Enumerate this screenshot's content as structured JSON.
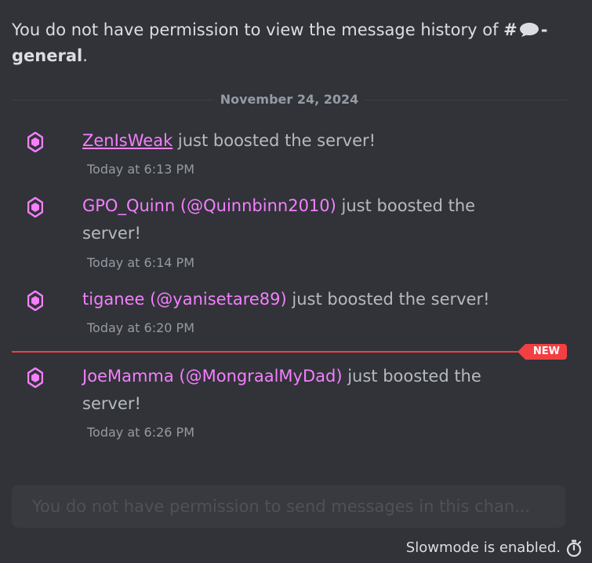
{
  "history_notice": {
    "prefix": "You do not have permission to view the message history of",
    "channel_hash": "#",
    "channel_name": "- general",
    "suffix": "."
  },
  "date_divider": {
    "label": "November 24, 2024"
  },
  "messages": [
    {
      "username": "ZenIsWeak",
      "action": " just boosted the server!",
      "timestamp": "Today at 6:13 PM"
    },
    {
      "username": "GPO_Quinn (@Quinnbinn2010)",
      "action": " just boosted the server!",
      "timestamp": "Today at 6:14 PM"
    },
    {
      "username": "tiganee (@yanisetare89)",
      "action": " just boosted the server!",
      "timestamp": "Today at 6:20 PM"
    },
    {
      "username": "JoeMamma (@MongraalMyDad)",
      "action": " just boosted the server!",
      "timestamp": "Today at 6:26 PM"
    }
  ],
  "new_divider": {
    "badge": "NEW"
  },
  "composer": {
    "placeholder": "You do not have permission to send messages in this chan..."
  },
  "footer": {
    "slowmode_label": "Slowmode is enabled.",
    "slowmode_icon": "stopwatch-icon"
  },
  "colors": {
    "background": "#313338",
    "boost_pink": "#f47fff",
    "new_red": "#f23f43",
    "muted_text": "#b5bac1"
  }
}
